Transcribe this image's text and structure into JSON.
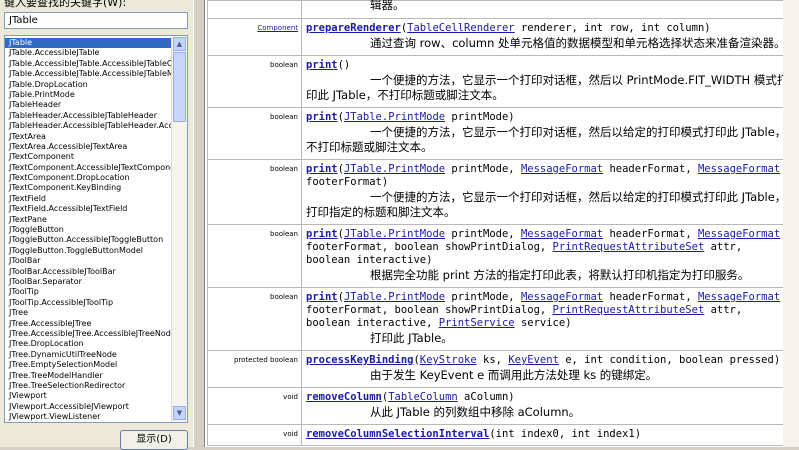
{
  "index": {
    "prompt": "键入要查找的关键字(W):",
    "keyword": "JTable",
    "items": [
      "JTable",
      "JTable.AccessibleJTable",
      "JTable.AccessibleJTable.AccessibleJTableCell",
      "JTable.AccessibleJTable.AccessibleJTableModel",
      "JTable.DropLocation",
      "JTable.PrintMode",
      "JTableHeader",
      "JTableHeader.AccessibleJTableHeader",
      "JTableHeader.AccessibleJTableHeader.Accessit",
      "JTextArea",
      "JTextArea.AccessibleJTextArea",
      "JTextComponent",
      "JTextComponent.AccessibleJTextComponent",
      "JTextComponent.DropLocation",
      "JTextComponent.KeyBinding",
      "JTextField",
      "JTextField.AccessibleJTextField",
      "JTextPane",
      "JToggleButton",
      "JToggleButton.AccessibleJToggleButton",
      "JToggleButton.ToggleButtonModel",
      "JToolBar",
      "JToolBar.AccessibleJToolBar",
      "JToolBar.Separator",
      "JToolTip",
      "JToolTip.AccessibleJToolTip",
      "JTree",
      "JTree.AccessibleJTree",
      "JTree.AccessibleJTree.AccessibleJTreeNode",
      "JTree.DropLocation",
      "JTree.DynamicUtilTreeNode",
      "JTree.EmptySelectionModel",
      "JTree.TreeModelHandler",
      "JTree.TreeSelectionRedirector",
      "JViewport",
      "JViewport.AccessibleJViewport",
      "JViewport.ViewListener"
    ],
    "selected_index": 0,
    "show_button": "显示(D)",
    "scroll_up": "▲",
    "scroll_down": "▼"
  },
  "doc": {
    "top_desc": "辑器。",
    "rows": [
      {
        "ret_link": "Component",
        "sig_parts": [
          {
            "t": "prepareRenderer",
            "k": "m"
          },
          {
            "t": "(",
            "k": "p"
          },
          {
            "t": "TableCellRenderer",
            "k": "l"
          },
          {
            "t": " renderer, int row, int column)",
            "k": "p"
          }
        ],
        "desc": "通过查询 row、column 处单元格值的数据模型和单元格选择状态来准备渲染器。"
      },
      {
        "ret": "boolean",
        "sig_parts": [
          {
            "t": "print",
            "k": "m"
          },
          {
            "t": "()",
            "k": "p"
          }
        ],
        "desc": "一个便捷的方法，它显示一个打印对话框，然后以 PrintMode.FIT_WIDTH 模式打印此 JTable，不打印标题或脚注文本。"
      },
      {
        "ret": "boolean",
        "sig_parts": [
          {
            "t": "print",
            "k": "m"
          },
          {
            "t": "(",
            "k": "p"
          },
          {
            "t": "JTable.PrintMode",
            "k": "l"
          },
          {
            "t": " printMode)",
            "k": "p"
          }
        ],
        "desc": "一个便捷的方法，它显示一个打印对话框，然后以给定的打印模式打印此 JTable，不打印标题或脚注文本。"
      },
      {
        "ret": "boolean",
        "sig_parts": [
          {
            "t": "print",
            "k": "m"
          },
          {
            "t": "(",
            "k": "p"
          },
          {
            "t": "JTable.PrintMode",
            "k": "l"
          },
          {
            "t": " printMode, ",
            "k": "p"
          },
          {
            "t": "MessageFormat",
            "k": "l"
          },
          {
            "t": " headerFormat, ",
            "k": "p"
          },
          {
            "t": "MessageFormat",
            "k": "l"
          },
          {
            "t": " footerFormat)",
            "k": "p"
          }
        ],
        "desc": "一个便捷的方法，它显示一个打印对话框，然后以给定的打印模式打印此 JTable，打印指定的标题和脚注文本。"
      },
      {
        "ret": "boolean",
        "sig_parts": [
          {
            "t": "print",
            "k": "m"
          },
          {
            "t": "(",
            "k": "p"
          },
          {
            "t": "JTable.PrintMode",
            "k": "l"
          },
          {
            "t": " printMode, ",
            "k": "p"
          },
          {
            "t": "MessageFormat",
            "k": "l"
          },
          {
            "t": " headerFormat, ",
            "k": "p"
          },
          {
            "t": "MessageFormat",
            "k": "l"
          },
          {
            "t": " footerFormat, boolean showPrintDialog, ",
            "k": "p"
          },
          {
            "t": "PrintRequestAttributeSet",
            "k": "l"
          },
          {
            "t": " attr, boolean interactive)",
            "k": "p"
          }
        ],
        "desc": "根据完全功能 print 方法的指定打印此表，将默认打印机指定为打印服务。"
      },
      {
        "ret": "boolean",
        "sig_parts": [
          {
            "t": "print",
            "k": "m"
          },
          {
            "t": "(",
            "k": "p"
          },
          {
            "t": "JTable.PrintMode",
            "k": "l"
          },
          {
            "t": " printMode, ",
            "k": "p"
          },
          {
            "t": "MessageFormat",
            "k": "l"
          },
          {
            "t": " headerFormat, ",
            "k": "p"
          },
          {
            "t": "MessageFormat",
            "k": "l"
          },
          {
            "t": " footerFormat, boolean showPrintDialog, ",
            "k": "p"
          },
          {
            "t": "PrintRequestAttributeSet",
            "k": "l"
          },
          {
            "t": " attr, boolean interactive, ",
            "k": "p"
          },
          {
            "t": "PrintService",
            "k": "l"
          },
          {
            "t": " service)",
            "k": "p"
          }
        ],
        "desc": "打印此 JTable。"
      },
      {
        "ret": "protected  boolean",
        "sig_parts": [
          {
            "t": "processKeyBinding",
            "k": "m"
          },
          {
            "t": "(",
            "k": "p"
          },
          {
            "t": "KeyStroke",
            "k": "l"
          },
          {
            "t": " ks, ",
            "k": "p"
          },
          {
            "t": "KeyEvent",
            "k": "l"
          },
          {
            "t": " e, int condition, boolean pressed)",
            "k": "p"
          }
        ],
        "desc": "由于发生 KeyEvent e 而调用此方法处理 ks 的键绑定。"
      },
      {
        "ret": "void",
        "sig_parts": [
          {
            "t": "removeColumn",
            "k": "m"
          },
          {
            "t": "(",
            "k": "p"
          },
          {
            "t": "TableColumn",
            "k": "l"
          },
          {
            "t": " aColumn)",
            "k": "p"
          }
        ],
        "desc": "从此 JTable 的列数组中移除 aColumn。"
      },
      {
        "ret": "void",
        "sig_parts": [
          {
            "t": "removeColumnSelectionInterval",
            "k": "m"
          },
          {
            "t": "(int index0, int index1)",
            "k": "p"
          }
        ],
        "desc": ""
      }
    ]
  }
}
